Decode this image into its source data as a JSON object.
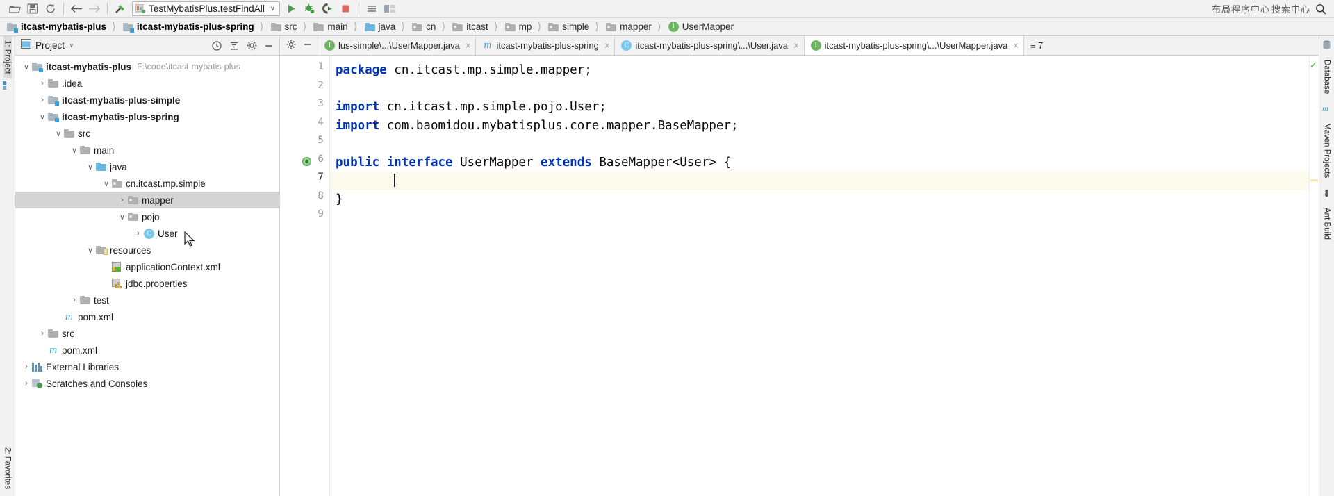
{
  "toolbar": {
    "icons": [
      "open-folder-icon",
      "save-all-icon",
      "sync-icon",
      "back-arrow-icon",
      "forward-arrow-icon",
      "build-hammer-icon"
    ],
    "run_config": {
      "name": "TestMybatisPlus.testFindAll",
      "dropdown": "∨"
    },
    "actions": [
      "run-icon",
      "debug-icon",
      "run-with-coverage-icon",
      "stop-icon",
      "more-icon"
    ],
    "right_text_1": "布局程序中心",
    "right_text_2": "搜索中心",
    "search_icon": "search-icon"
  },
  "breadcrumb": [
    {
      "label": "itcast-mybatis-plus",
      "icon": "module-folder-icon",
      "bold": true
    },
    {
      "label": "itcast-mybatis-plus-spring",
      "icon": "module-folder-icon",
      "bold": true
    },
    {
      "label": "src",
      "icon": "folder-icon",
      "bold": false
    },
    {
      "label": "main",
      "icon": "folder-icon",
      "bold": false
    },
    {
      "label": "java",
      "icon": "source-folder-icon",
      "bold": false
    },
    {
      "label": "cn",
      "icon": "package-icon",
      "bold": false
    },
    {
      "label": "itcast",
      "icon": "package-icon",
      "bold": false
    },
    {
      "label": "mp",
      "icon": "package-icon",
      "bold": false
    },
    {
      "label": "simple",
      "icon": "package-icon",
      "bold": false
    },
    {
      "label": "mapper",
      "icon": "package-icon",
      "bold": false
    },
    {
      "label": "UserMapper",
      "icon": "interface-icon",
      "bold": false
    }
  ],
  "left_strip": {
    "project_tab": "1: Project",
    "favorites_tab": "2: Favorites",
    "structure_icon": "structure-icon"
  },
  "right_strip": {
    "tabs": [
      "Database",
      "Maven Projects",
      "Ant Build"
    ]
  },
  "project_panel": {
    "title": "Project",
    "caret": "∨",
    "actions": [
      "collapse-scope-icon",
      "collapse-all-icon",
      "settings-gear-icon",
      "hide-panel-icon"
    ],
    "tree": [
      {
        "indent": 0,
        "arrow": "∨",
        "icon": "module-folder-icon",
        "label": "itcast-mybatis-plus",
        "bold": true,
        "path": "F:\\code\\itcast-mybatis-plus",
        "selected": false
      },
      {
        "indent": 1,
        "arrow": "›",
        "icon": "folder-icon",
        "label": ".idea",
        "bold": false,
        "path": "",
        "selected": false
      },
      {
        "indent": 1,
        "arrow": "›",
        "icon": "module-folder-icon",
        "label": "itcast-mybatis-plus-simple",
        "bold": true,
        "path": "",
        "selected": false
      },
      {
        "indent": 1,
        "arrow": "∨",
        "icon": "module-folder-icon",
        "label": "itcast-mybatis-plus-spring",
        "bold": true,
        "path": "",
        "selected": false
      },
      {
        "indent": 2,
        "arrow": "∨",
        "icon": "folder-icon",
        "label": "src",
        "bold": false,
        "path": "",
        "selected": false
      },
      {
        "indent": 3,
        "arrow": "∨",
        "icon": "folder-icon",
        "label": "main",
        "bold": false,
        "path": "",
        "selected": false
      },
      {
        "indent": 4,
        "arrow": "∨",
        "icon": "source-folder-icon",
        "label": "java",
        "bold": false,
        "path": "",
        "selected": false
      },
      {
        "indent": 5,
        "arrow": "∨",
        "icon": "package-icon",
        "label": "cn.itcast.mp.simple",
        "bold": false,
        "path": "",
        "selected": false
      },
      {
        "indent": 6,
        "arrow": "›",
        "icon": "package-icon",
        "label": "mapper",
        "bold": false,
        "path": "",
        "selected": true
      },
      {
        "indent": 6,
        "arrow": "∨",
        "icon": "package-icon",
        "label": "pojo",
        "bold": false,
        "path": "",
        "selected": false
      },
      {
        "indent": 7,
        "arrow": "›",
        "icon": "class-icon",
        "label": "User",
        "bold": false,
        "path": "",
        "selected": false
      },
      {
        "indent": 4,
        "arrow": "∨",
        "icon": "resources-folder-icon",
        "label": "resources",
        "bold": false,
        "path": "",
        "selected": false
      },
      {
        "indent": 5,
        "arrow": "",
        "icon": "xml-file-icon",
        "label": "applicationContext.xml",
        "bold": false,
        "path": "",
        "selected": false
      },
      {
        "indent": 5,
        "arrow": "",
        "icon": "properties-file-icon",
        "label": "jdbc.properties",
        "bold": false,
        "path": "",
        "selected": false
      },
      {
        "indent": 3,
        "arrow": "›",
        "icon": "folder-icon",
        "label": "test",
        "bold": false,
        "path": "",
        "selected": false
      },
      {
        "indent": 2,
        "arrow": "",
        "icon": "maven-file-icon",
        "label": "pom.xml",
        "bold": false,
        "path": "",
        "selected": false
      },
      {
        "indent": 1,
        "arrow": "›",
        "icon": "folder-icon",
        "label": "src",
        "bold": false,
        "path": "",
        "selected": false
      },
      {
        "indent": 1,
        "arrow": "",
        "icon": "maven-file-icon",
        "label": "pom.xml",
        "bold": false,
        "path": "",
        "selected": false
      },
      {
        "indent": 0,
        "arrow": "›",
        "icon": "libraries-icon",
        "label": "External Libraries",
        "bold": false,
        "path": "",
        "selected": false
      },
      {
        "indent": 0,
        "arrow": "›",
        "icon": "scratches-icon",
        "label": "Scratches and Consoles",
        "bold": false,
        "path": "",
        "selected": false
      }
    ]
  },
  "editor": {
    "tabs": [
      {
        "label": "lus-simple\\...\\UserMapper.java",
        "icon": "interface-icon",
        "active": false,
        "close": "×"
      },
      {
        "label": "itcast-mybatis-plus-spring",
        "icon": "maven-file-icon",
        "active": false,
        "close": "×"
      },
      {
        "label": "itcast-mybatis-plus-spring\\...\\User.java",
        "icon": "class-icon",
        "active": false,
        "close": "×"
      },
      {
        "label": "itcast-mybatis-plus-spring\\...\\UserMapper.java",
        "icon": "interface-icon",
        "active": true,
        "close": "×"
      }
    ],
    "tabs_overflow": "≡ 7",
    "gutter_lines": [
      "1",
      "2",
      "3",
      "4",
      "5",
      "6",
      "7",
      "8",
      "9"
    ],
    "current_line": 7,
    "code_lines": [
      {
        "n": 1,
        "segments": [
          {
            "t": "package",
            "c": "kw"
          },
          {
            "t": " cn.itcast.mp.simple.mapper;",
            "c": "pl"
          }
        ]
      },
      {
        "n": 2,
        "segments": []
      },
      {
        "n": 3,
        "segments": [
          {
            "t": "import",
            "c": "kw"
          },
          {
            "t": " cn.itcast.mp.simple.pojo.User;",
            "c": "pl"
          }
        ]
      },
      {
        "n": 4,
        "segments": [
          {
            "t": "import",
            "c": "kw"
          },
          {
            "t": " com.baomidou.mybatisplus.core.mapper.BaseMapper;",
            "c": "pl"
          }
        ]
      },
      {
        "n": 5,
        "segments": []
      },
      {
        "n": 6,
        "segments": [
          {
            "t": "public",
            "c": "kw"
          },
          {
            "t": " ",
            "c": "pl"
          },
          {
            "t": "interface",
            "c": "kw"
          },
          {
            "t": " UserMapper ",
            "c": "pl"
          },
          {
            "t": "extends",
            "c": "kw"
          },
          {
            "t": " BaseMapper<User> {",
            "c": "pl"
          }
        ]
      },
      {
        "n": 7,
        "segments": []
      },
      {
        "n": 8,
        "segments": [
          {
            "t": "}",
            "c": "pl"
          }
        ]
      },
      {
        "n": 9,
        "segments": []
      }
    ],
    "inspection_status": "✓"
  }
}
